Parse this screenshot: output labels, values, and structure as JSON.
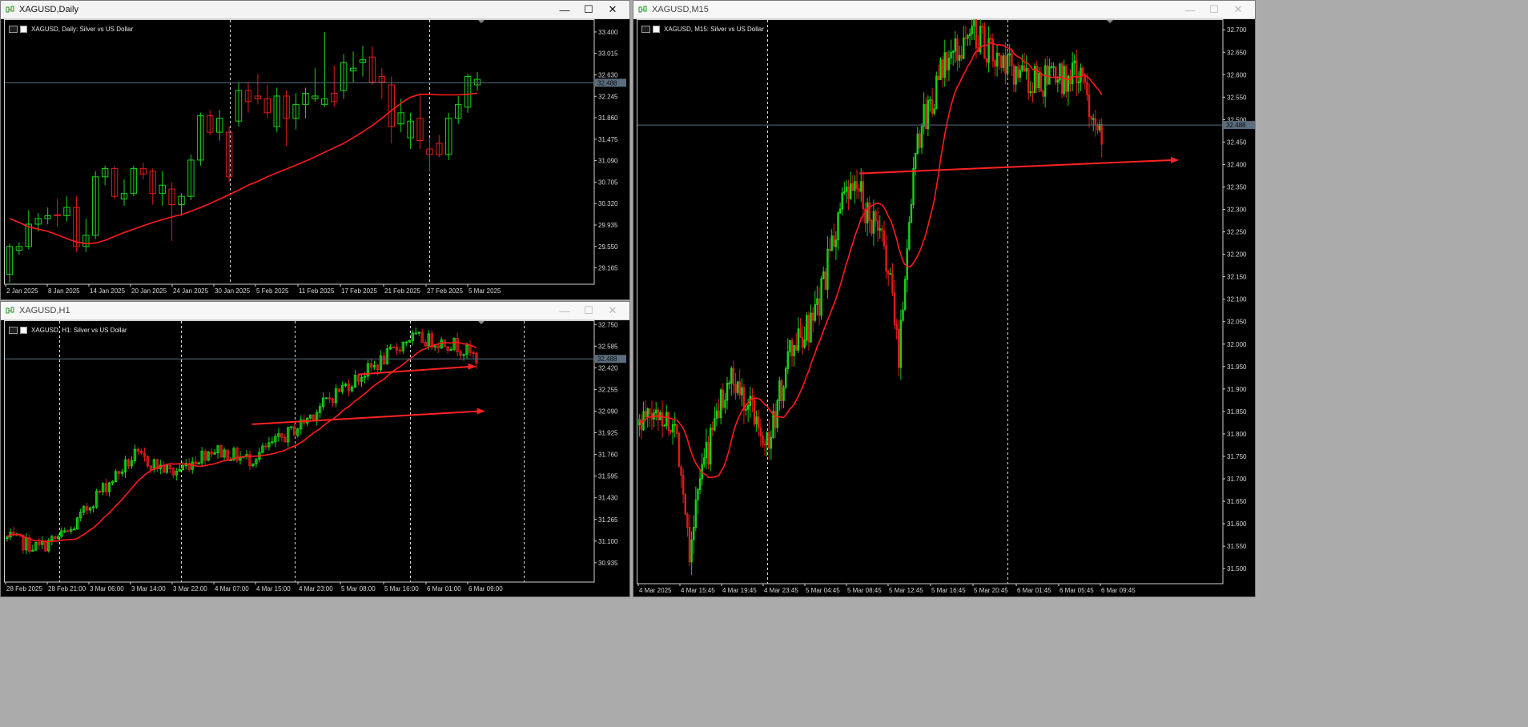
{
  "windows": {
    "daily": {
      "title": "XAGUSD,Daily",
      "header": "XAGUSD, Daily:  Silver vs US Dollar",
      "price_ticks": [
        "33.400",
        "33.015",
        "32.630",
        "32.245",
        "31.860",
        "31.475",
        "31.090",
        "30.705",
        "30.320",
        "29.935",
        "29.550",
        "29.165"
      ],
      "time_ticks": [
        "2 Jan 2025",
        "8 Jan 2025",
        "14 Jan 2025",
        "20 Jan 2025",
        "24 Jan 2025",
        "30 Jan 2025",
        "5 Feb 2025",
        "11 Feb 2025",
        "17 Feb 2025",
        "21 Feb 2025",
        "27 Feb 2025",
        "5 Mar 2025"
      ],
      "current_price": "32.488"
    },
    "h1": {
      "title": "XAGUSD,H1",
      "header": "XAGUSD, H1:  Silver vs US Dollar",
      "price_ticks": [
        "32.750",
        "32.585",
        "32.420",
        "32.255",
        "32.090",
        "31.925",
        "31.760",
        "31.595",
        "31.430",
        "31.265",
        "31.100",
        "30.935"
      ],
      "time_ticks": [
        "28 Feb 2025",
        "28 Feb 21:00",
        "3 Mar 06:00",
        "3 Mar 14:00",
        "3 Mar 22:00",
        "4 Mar 07:00",
        "4 Mar 15:00",
        "4 Mar 23:00",
        "5 Mar 08:00",
        "5 Mar 16:00",
        "6 Mar 01:00",
        "6 Mar 09:00"
      ],
      "current_price": "32.488"
    },
    "m15": {
      "title": "XAGUSD,M15",
      "header": "XAGUSD, M15:  Silver vs US Dollar",
      "price_ticks": [
        "32.700",
        "32.650",
        "32.600",
        "32.550",
        "32.500",
        "32.450",
        "32.400",
        "32.350",
        "32.300",
        "32.250",
        "32.200",
        "32.150",
        "32.100",
        "32.050",
        "32.000",
        "31.950",
        "31.900",
        "31.850",
        "31.800",
        "31.750",
        "31.700",
        "31.650",
        "31.600",
        "31.550",
        "31.500"
      ],
      "time_ticks": [
        "4 Mar 2025",
        "4 Mar 15:45",
        "4 Mar 19:45",
        "4 Mar 23:45",
        "5 Mar 04:45",
        "5 Mar 08:45",
        "5 Mar 12:45",
        "5 Mar 16:45",
        "5 Mar 20:45",
        "6 Mar 01:45",
        "6 Mar 05:45",
        "6 Mar 09:45"
      ],
      "current_price": "32.488"
    }
  },
  "controls": {
    "minimize": "—",
    "maximize": "☐",
    "close": "✕"
  },
  "icons": {
    "title_icon": "chart-candles-icon",
    "header_icon": "symbol-flag-icon"
  },
  "colors": {
    "bull": "#19d319",
    "bear": "#e01c1c",
    "ma": "#ff1a1a",
    "arrow": "#ff2222",
    "grid_sep": "#dcdcdc",
    "price_line": "#5a6f80",
    "price_label_bg": "#5b6d7e"
  },
  "chart_data": [
    {
      "type": "candlestick",
      "symbol": "XAGUSD",
      "timeframe": "Daily",
      "ylim": [
        28.9,
        33.6
      ],
      "current_price": 32.488,
      "ohlc": [
        [
          29.05,
          29.6,
          28.9,
          29.55
        ],
        [
          29.48,
          29.62,
          29.4,
          29.55
        ],
        [
          29.55,
          30.2,
          29.5,
          29.95
        ],
        [
          29.95,
          30.15,
          29.82,
          30.05
        ],
        [
          30.05,
          30.25,
          29.95,
          30.1
        ],
        [
          30.12,
          30.4,
          29.9,
          30.1
        ],
        [
          30.1,
          30.45,
          30.0,
          30.25
        ],
        [
          30.25,
          30.45,
          29.45,
          29.55
        ],
        [
          29.55,
          30.05,
          29.45,
          29.75
        ],
        [
          29.75,
          30.9,
          29.68,
          30.8
        ],
        [
          30.8,
          31.0,
          30.65,
          30.95
        ],
        [
          30.95,
          31.0,
          30.4,
          30.45
        ],
        [
          30.4,
          30.75,
          30.28,
          30.5
        ],
        [
          30.5,
          31.0,
          30.45,
          30.95
        ],
        [
          30.95,
          31.05,
          30.75,
          30.85
        ],
        [
          30.9,
          30.95,
          30.3,
          30.5
        ],
        [
          30.5,
          30.9,
          30.28,
          30.65
        ],
        [
          30.58,
          30.7,
          29.65,
          30.3
        ],
        [
          30.3,
          30.5,
          30.1,
          30.45
        ],
        [
          30.45,
          31.2,
          30.38,
          31.1
        ],
        [
          31.1,
          31.95,
          31.0,
          31.9
        ],
        [
          31.9,
          32.0,
          31.55,
          31.6
        ],
        [
          31.6,
          32.0,
          31.45,
          31.85
        ],
        [
          31.6,
          31.7,
          30.7,
          30.8
        ],
        [
          31.8,
          32.5,
          31.7,
          32.35
        ],
        [
          32.35,
          32.5,
          31.95,
          32.15
        ],
        [
          32.25,
          32.65,
          32.1,
          32.2
        ],
        [
          32.2,
          32.45,
          31.85,
          31.95
        ],
        [
          31.7,
          32.4,
          31.6,
          32.25
        ],
        [
          32.25,
          32.35,
          31.35,
          31.85
        ],
        [
          31.85,
          32.3,
          31.65,
          32.1
        ],
        [
          32.1,
          32.4,
          31.85,
          32.3
        ],
        [
          32.2,
          32.75,
          32.15,
          32.25
        ],
        [
          32.1,
          33.4,
          32.05,
          32.2
        ],
        [
          32.3,
          32.8,
          32.05,
          32.15
        ],
        [
          32.35,
          33.0,
          32.2,
          32.85
        ],
        [
          32.7,
          33.05,
          32.5,
          32.75
        ],
        [
          32.85,
          33.15,
          32.6,
          32.9
        ],
        [
          32.95,
          33.15,
          32.45,
          32.5
        ],
        [
          32.6,
          32.75,
          32.2,
          32.5
        ],
        [
          32.45,
          32.6,
          31.4,
          31.7
        ],
        [
          31.75,
          32.2,
          31.6,
          31.95
        ],
        [
          31.5,
          31.95,
          31.3,
          31.8
        ],
        [
          31.85,
          32.3,
          31.3,
          31.45
        ],
        [
          31.3,
          31.5,
          30.9,
          31.2
        ],
        [
          31.4,
          31.55,
          31.15,
          31.2
        ],
        [
          31.2,
          31.95,
          31.1,
          31.85
        ],
        [
          31.85,
          32.25,
          31.75,
          32.1
        ],
        [
          32.05,
          32.65,
          31.95,
          32.6
        ],
        [
          32.45,
          32.68,
          32.35,
          32.55
        ]
      ],
      "ma": [
        30.05,
        29.98,
        29.9,
        29.86,
        29.82,
        29.76,
        29.69,
        29.63,
        29.6,
        29.61,
        29.66,
        29.73,
        29.8,
        29.86,
        29.92,
        29.98,
        30.03,
        30.08,
        30.12,
        30.18,
        30.25,
        30.32,
        30.4,
        30.48,
        30.56,
        30.65,
        30.72,
        30.8,
        30.87,
        30.94,
        31.01,
        31.08,
        31.16,
        31.24,
        31.32,
        31.4,
        31.5,
        31.61,
        31.72,
        31.85,
        31.99,
        32.12,
        32.23,
        32.28,
        32.28,
        32.27,
        32.27,
        32.27,
        32.28,
        32.3
      ],
      "arrows": []
    },
    {
      "type": "candlestick",
      "symbol": "XAGUSD",
      "timeframe": "H1",
      "ylim": [
        30.8,
        32.77
      ],
      "current_price": 32.488,
      "ohlc": [],
      "ma": [],
      "arrows": [
        [
          31.99,
          32.09
        ],
        [
          32.37,
          32.43
        ]
      ]
    },
    {
      "type": "candlestick",
      "symbol": "XAGUSD",
      "timeframe": "M15",
      "ylim": [
        31.47,
        32.72
      ],
      "current_price": 32.488,
      "ohlc": [],
      "ma": [],
      "arrows": [
        [
          32.38,
          32.41
        ]
      ]
    }
  ]
}
